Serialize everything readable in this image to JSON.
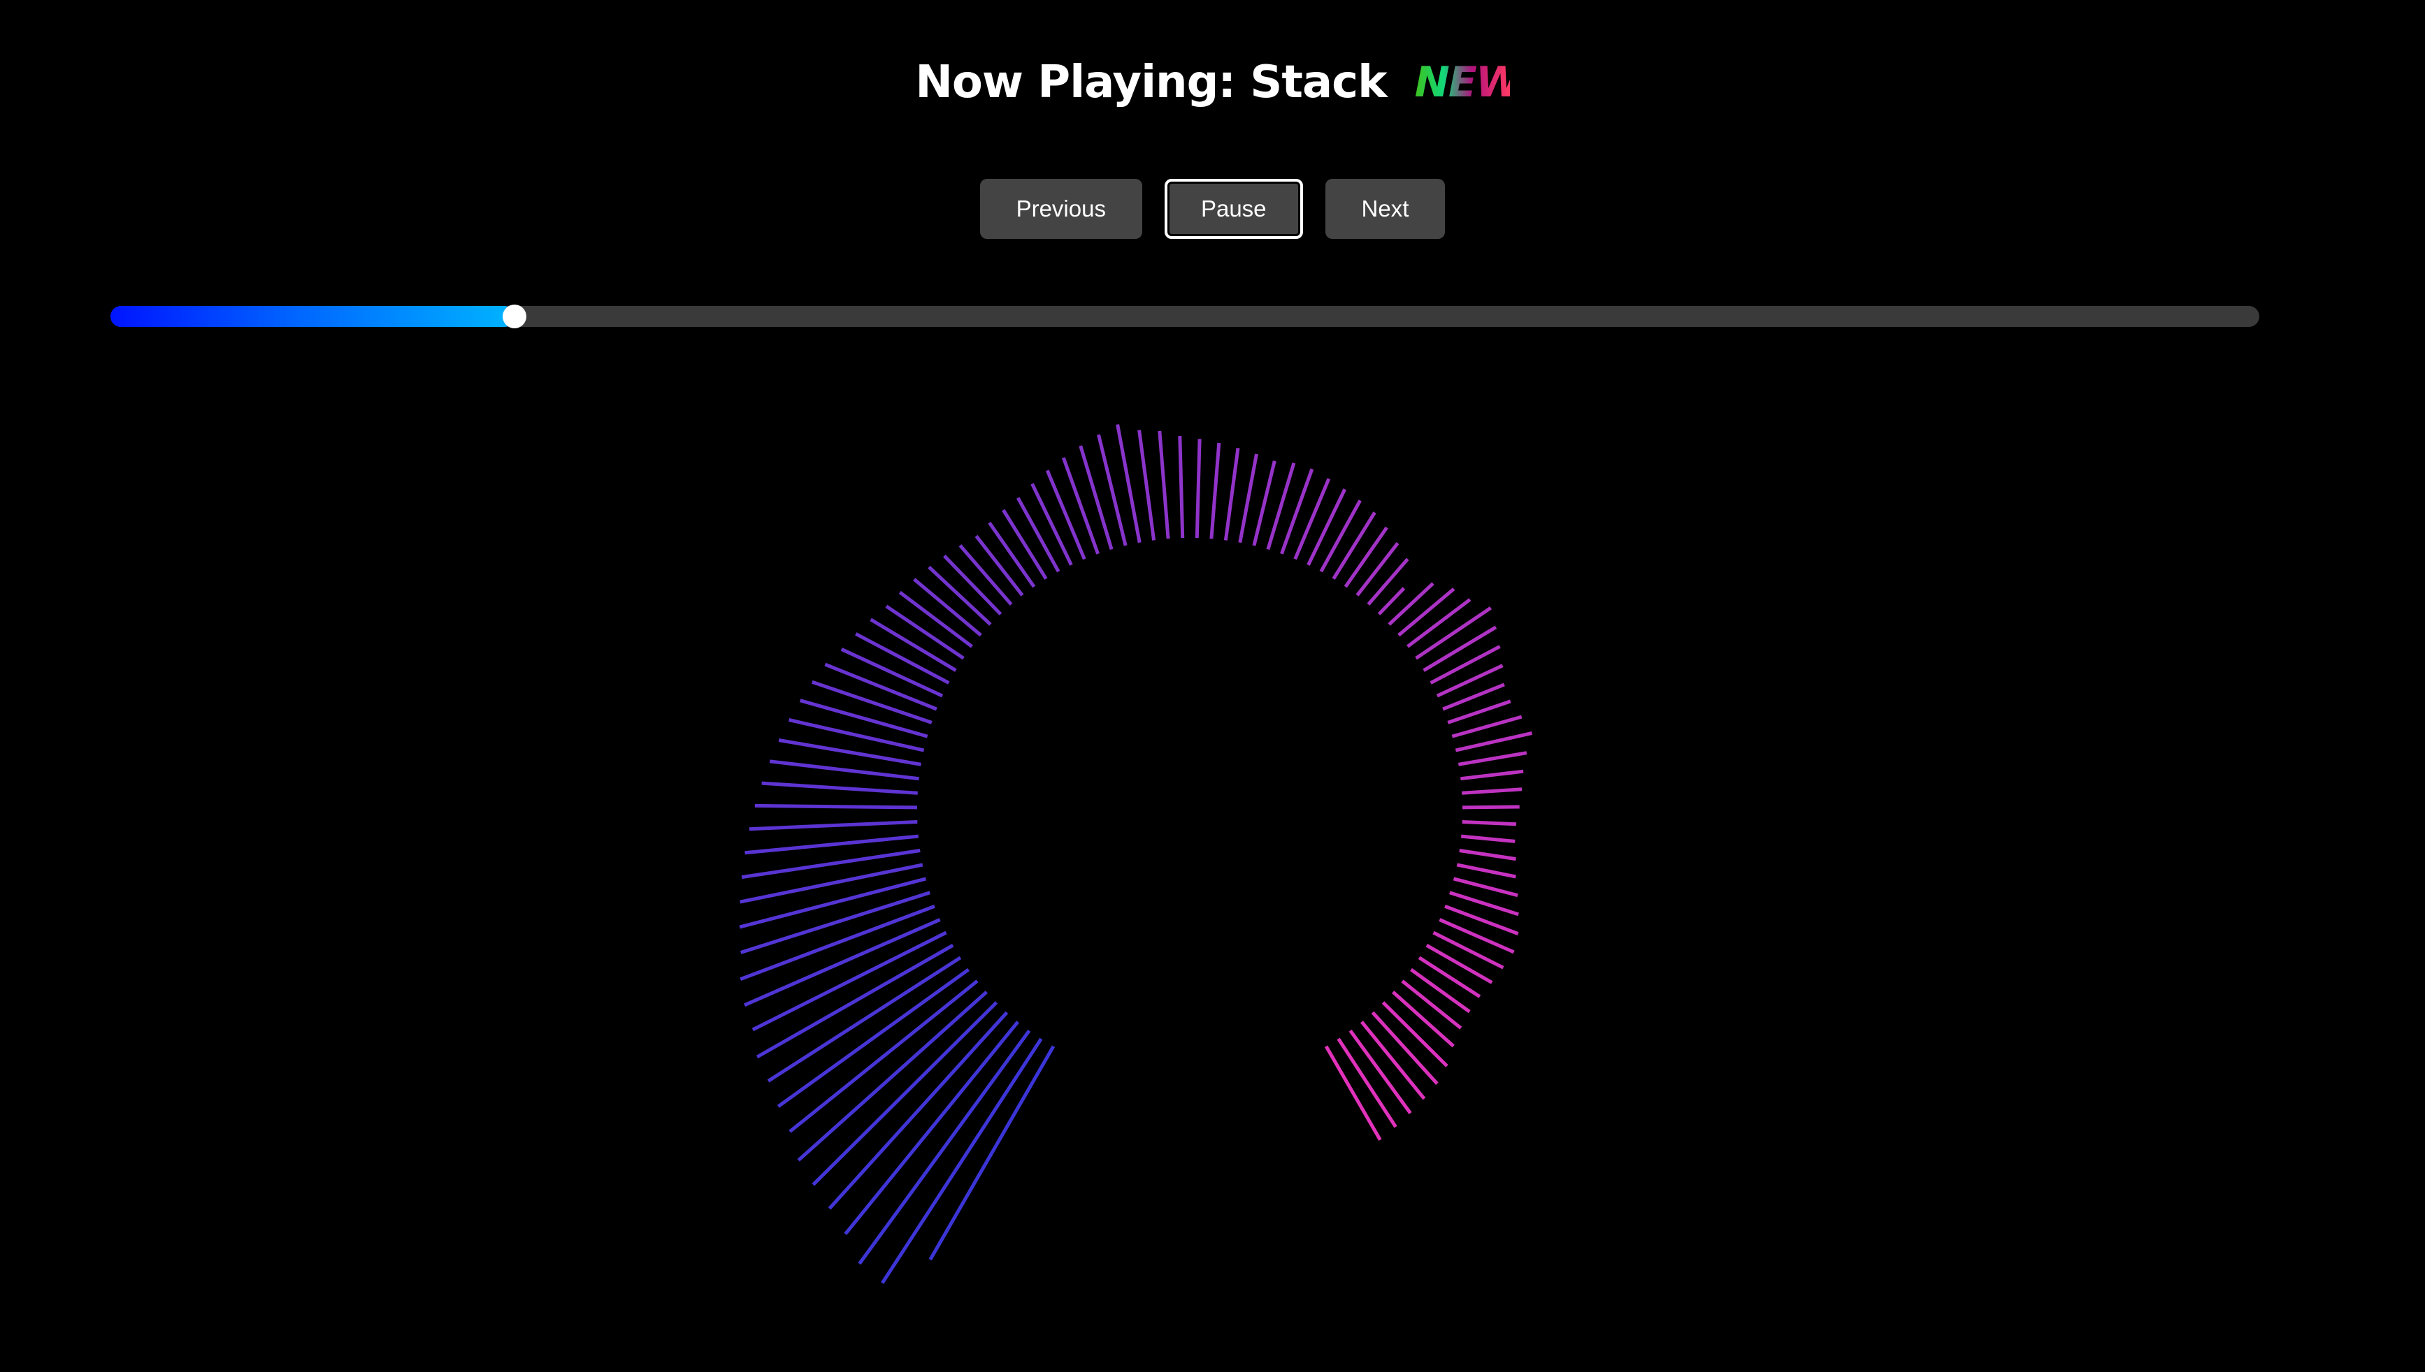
{
  "header": {
    "title": "Now Playing: Stack",
    "badge": "NEW"
  },
  "controls": {
    "previous_label": "Previous",
    "pause_label": "Pause",
    "next_label": "Next"
  },
  "progress": {
    "fraction": 0.188,
    "fill_start_color": "#0014ff",
    "fill_end_color": "#00b4ff",
    "thumb_color": "#ffffff"
  },
  "visualizer": {
    "start_color": "#3b35d8",
    "end_color": "#e232bb",
    "bar_count": 100,
    "sweep_degrees": 300,
    "levels": [
      0.82,
      0.97,
      0.96,
      0.91,
      0.88,
      0.86,
      0.84,
      0.8,
      0.78,
      0.76,
      0.75,
      0.72,
      0.71,
      0.69,
      0.66,
      0.64,
      0.62,
      0.6,
      0.58,
      0.56,
      0.54,
      0.52,
      0.5,
      0.48,
      0.46,
      0.44,
      0.42,
      0.4,
      0.37,
      0.35,
      0.33,
      0.31,
      0.3,
      0.29,
      0.28,
      0.27,
      0.26,
      0.25,
      0.26,
      0.27,
      0.28,
      0.3,
      0.32,
      0.34,
      0.36,
      0.38,
      0.4,
      0.37,
      0.36,
      0.34,
      0.33,
      0.32,
      0.31,
      0.3,
      0.29,
      0.3,
      0.3,
      0.29,
      0.28,
      0.27,
      0.26,
      0.24,
      0.22,
      0.2,
      0.12,
      0.2,
      0.24,
      0.26,
      0.3,
      0.28,
      0.26,
      0.24,
      0.22,
      0.22,
      0.24,
      0.26,
      0.23,
      0.21,
      0.2,
      0.19,
      0.18,
      0.18,
      0.19,
      0.2,
      0.22,
      0.24,
      0.26,
      0.27,
      0.26,
      0.25,
      0.24,
      0.24,
      0.25,
      0.27,
      0.3,
      0.32,
      0.33,
      0.34,
      0.35,
      0.36
    ]
  }
}
